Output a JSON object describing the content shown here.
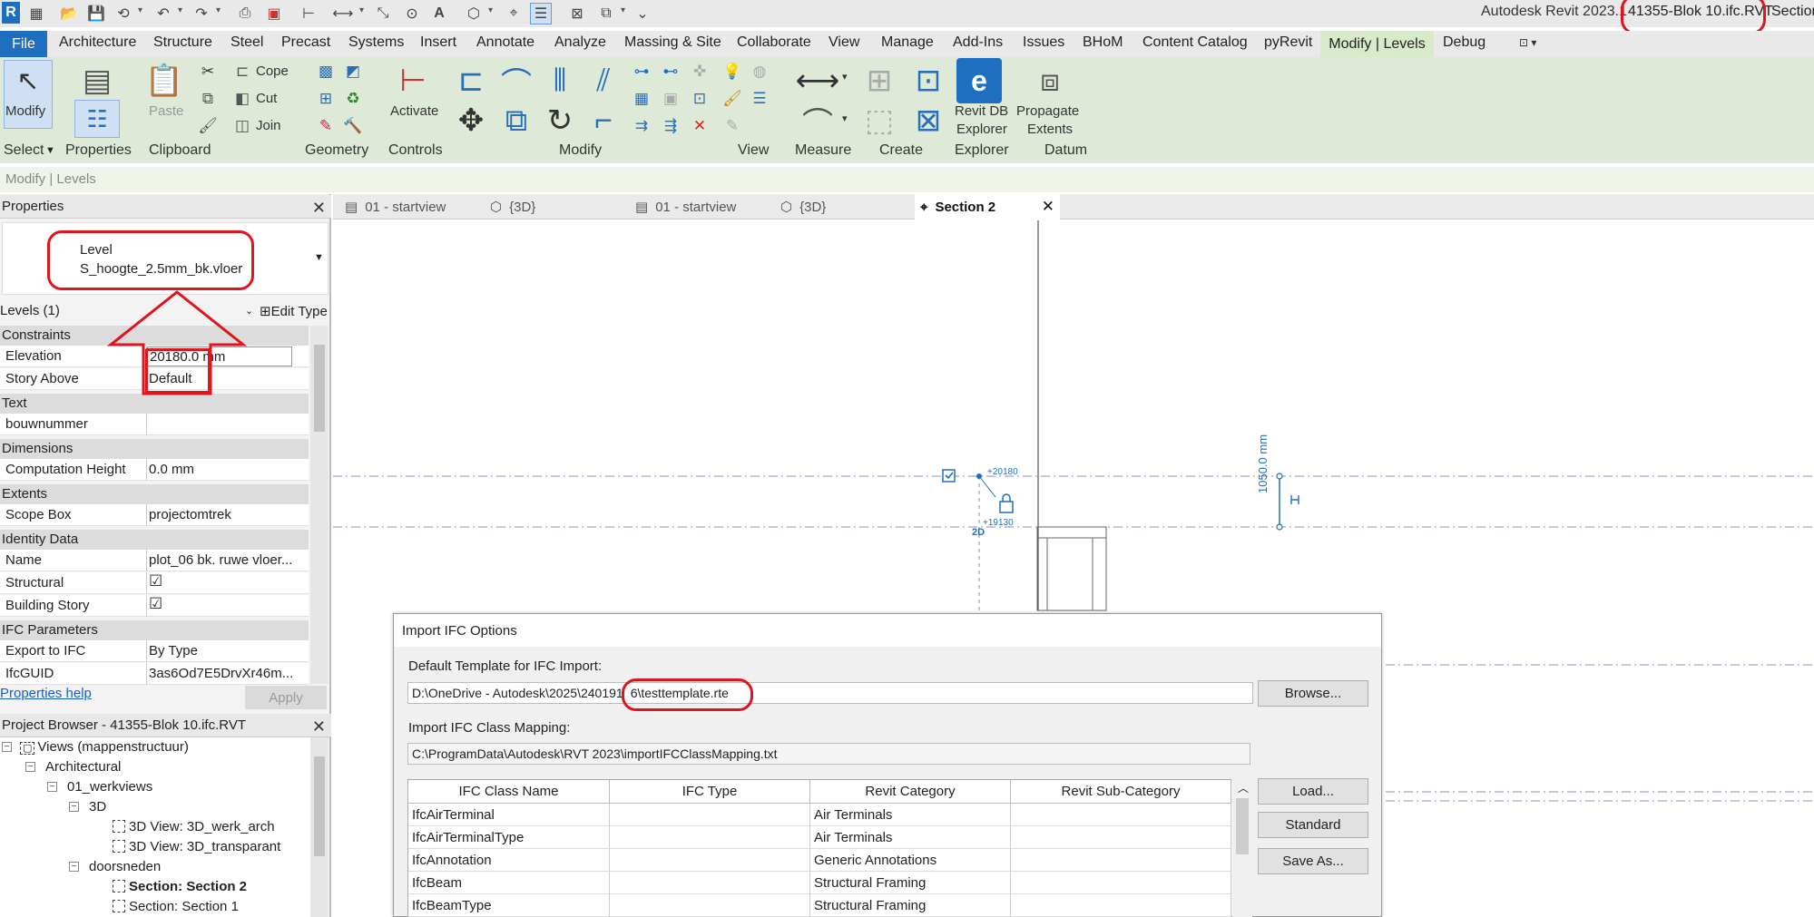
{
  "app": {
    "title": "Autodesk Revit 2023.1",
    "filename": "41355-Blok 10.ifc.RVT",
    "title_suffix": "Section",
    "logo_letter": "R"
  },
  "menu": {
    "file": "File",
    "tabs": [
      "Architecture",
      "Structure",
      "Steel",
      "Precast",
      "Systems",
      "Insert",
      "Annotate",
      "Analyze",
      "Massing & Site",
      "Collaborate",
      "View",
      "Manage",
      "Add-Ins",
      "Issues",
      "BHoM",
      "Content Catalog",
      "pyRevit"
    ],
    "active_tab": "Modify | Levels",
    "debug": "Debug"
  },
  "ribbon": {
    "modify": "Modify",
    "properties": "Properties",
    "paste": "Paste",
    "cope": "Cope",
    "cut": "Cut",
    "join": "Join",
    "activate": "Activate",
    "revit_db": "Revit DB",
    "explorer": "Explorer",
    "propagate": "Propagate",
    "extents": "Extents",
    "panels": {
      "select": "Select",
      "properties": "Properties",
      "clipboard": "Clipboard",
      "geometry": "Geometry",
      "controls": "Controls",
      "modify": "Modify",
      "view": "View",
      "measure": "Measure",
      "create": "Create",
      "explorer": "Explorer",
      "datum": "Datum"
    }
  },
  "context_bar": "Modify | Levels",
  "properties": {
    "header": "Properties",
    "type_family": "Level",
    "type_name": "S_hoogte_2.5mm_bk.vloer",
    "instance_filter": "Levels (1)",
    "edit_type": "Edit Type",
    "groups": {
      "constraints": "Constraints",
      "text": "Text",
      "dimensions": "Dimensions",
      "extents": "Extents",
      "identity": "Identity Data",
      "ifc": "IFC Parameters"
    },
    "rows": {
      "elevation": {
        "key": "Elevation",
        "value": "20180.0 mm"
      },
      "story_above": {
        "key": "Story Above",
        "value": "Default"
      },
      "bouwnummer": {
        "key": "bouwnummer",
        "value": ""
      },
      "comp_height": {
        "key": "Computation Height",
        "value": "0.0 mm"
      },
      "scope_box": {
        "key": "Scope Box",
        "value": "projectomtrek"
      },
      "name": {
        "key": "Name",
        "value": "plot_06 bk. ruwe vloer..."
      },
      "structural": {
        "key": "Structural",
        "value": "☑"
      },
      "building_story": {
        "key": "Building Story",
        "value": "☑"
      },
      "export_ifc": {
        "key": "Export to IFC",
        "value": "By Type"
      },
      "ifcguid": {
        "key": "IfcGUID",
        "value": "3as6Od7E5DrvXr46m..."
      }
    },
    "help": "Properties help",
    "apply": "Apply"
  },
  "project_browser": {
    "header": "Project Browser - 41355-Blok 10.ifc.RVT",
    "items": [
      "Views (mappenstructuur)",
      "Architectural",
      "01_werkviews",
      "3D",
      "3D View: 3D_werk_arch",
      "3D View: 3D_transparant",
      "doorsneden",
      "Section: Section 2",
      "Section: Section 1"
    ]
  },
  "view_tabs": [
    "01 - startview",
    "{3D}",
    "01 - startview",
    "{3D}",
    "Section 2"
  ],
  "canvas": {
    "level_top": "+20180",
    "level_bottom": "+19130",
    "dim_text": "1050.0 mm",
    "label_2d": "2D"
  },
  "dialog": {
    "title": "Import IFC Options",
    "template_label": "Default Template for IFC Import:",
    "template_path": "D:\\OneDrive - Autodesk\\2025\\240191",
    "template_file": "6\\testtemplate.rte",
    "browse": "Browse...",
    "mapping_label": "Import IFC Class Mapping:",
    "mapping_path": "C:\\ProgramData\\Autodesk\\RVT 2023\\importIFCClassMapping.txt",
    "columns": [
      "IFC Class Name",
      "IFC Type",
      "Revit Category",
      "Revit Sub-Category"
    ],
    "rows": [
      [
        "IfcAirTerminal",
        "",
        "Air Terminals",
        ""
      ],
      [
        "IfcAirTerminalType",
        "",
        "Air Terminals",
        ""
      ],
      [
        "IfcAnnotation",
        "",
        "Generic Annotations",
        ""
      ],
      [
        "IfcBeam",
        "",
        "Structural Framing",
        ""
      ],
      [
        "IfcBeamType",
        "",
        "Structural Framing",
        ""
      ]
    ],
    "load": "Load...",
    "standard": "Standard",
    "save_as": "Save As..."
  }
}
